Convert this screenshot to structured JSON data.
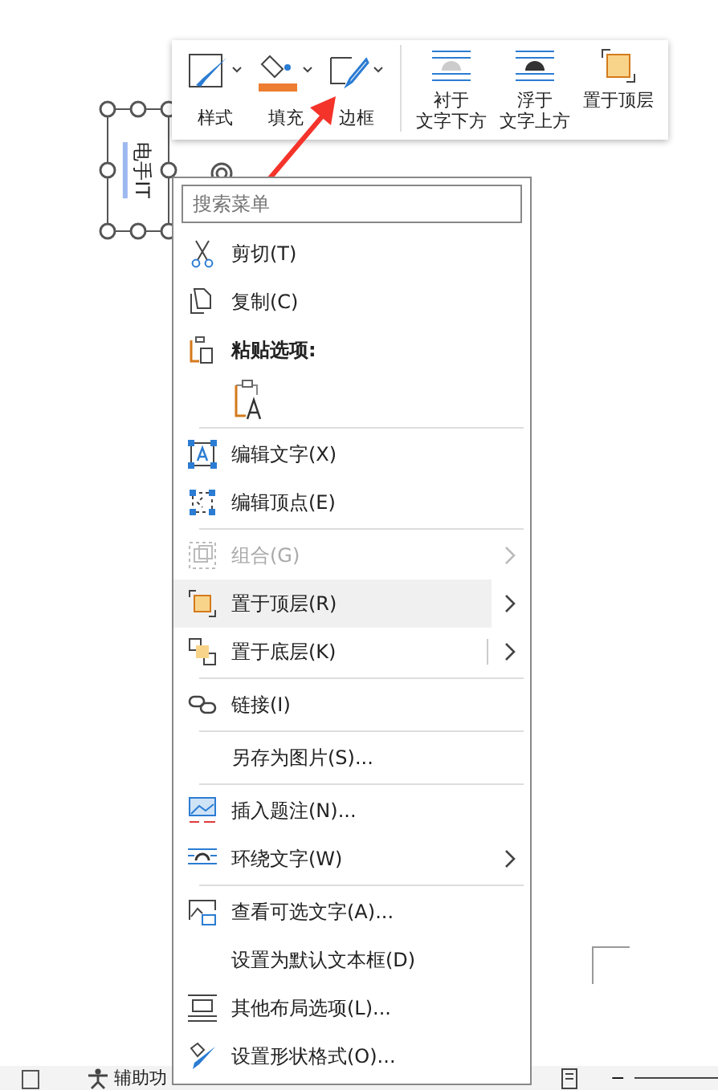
{
  "text_box": {
    "text": "电手IT"
  },
  "toolbar": {
    "format": [
      {
        "label": "样式",
        "dropdown": true
      },
      {
        "label": "填充",
        "dropdown": true
      },
      {
        "label": "边框",
        "dropdown": true
      }
    ],
    "arrange": [
      {
        "lines": [
          "衬于",
          "文字下方"
        ]
      },
      {
        "lines": [
          "浮于",
          "文字上方"
        ]
      },
      {
        "lines": [
          "置于顶层"
        ]
      }
    ]
  },
  "menu": {
    "search": {
      "placeholder": "搜索菜单"
    },
    "items": [
      {
        "kind": "item",
        "label": "剪切(T)",
        "disabled": false,
        "selected": false,
        "submenu": false,
        "split": false
      },
      {
        "kind": "item",
        "label": "复制(C)",
        "disabled": false,
        "selected": false,
        "submenu": false,
        "split": false
      },
      {
        "kind": "header",
        "label": "粘贴选项:"
      },
      {
        "kind": "paste-option"
      },
      {
        "kind": "divider"
      },
      {
        "kind": "item",
        "label": "编辑文字(X)",
        "disabled": false,
        "selected": false,
        "submenu": false,
        "split": false
      },
      {
        "kind": "item",
        "label": "编辑顶点(E)",
        "disabled": false,
        "selected": false,
        "submenu": false,
        "split": false
      },
      {
        "kind": "divider"
      },
      {
        "kind": "item",
        "label": "组合(G)",
        "disabled": true,
        "selected": false,
        "submenu": true,
        "split": false
      },
      {
        "kind": "item",
        "label": "置于顶层(R)",
        "disabled": false,
        "selected": true,
        "submenu": true,
        "split": false
      },
      {
        "kind": "item",
        "label": "置于底层(K)",
        "disabled": false,
        "selected": false,
        "submenu": true,
        "split": true
      },
      {
        "kind": "divider"
      },
      {
        "kind": "item",
        "label": "链接(I)",
        "disabled": false,
        "selected": false,
        "submenu": false,
        "split": false
      },
      {
        "kind": "divider"
      },
      {
        "kind": "item",
        "label": "另存为图片(S)...",
        "disabled": false,
        "selected": false,
        "submenu": false,
        "split": false
      },
      {
        "kind": "divider"
      },
      {
        "kind": "item",
        "label": "插入题注(N)...",
        "disabled": false,
        "selected": false,
        "submenu": false,
        "split": false
      },
      {
        "kind": "item",
        "label": "环绕文字(W)",
        "disabled": false,
        "selected": false,
        "submenu": true,
        "split": false
      },
      {
        "kind": "divider"
      },
      {
        "kind": "item",
        "label": "查看可选文字(A)...",
        "disabled": false,
        "selected": false,
        "submenu": false,
        "split": false
      },
      {
        "kind": "item",
        "label": "设置为默认文本框(D)",
        "disabled": false,
        "selected": false,
        "submenu": false,
        "split": false
      },
      {
        "kind": "item",
        "label": "其他布局选项(L)...",
        "disabled": false,
        "selected": false,
        "submenu": false,
        "split": false
      },
      {
        "kind": "item",
        "label": "设置形状格式(O)...",
        "disabled": false,
        "selected": false,
        "submenu": false,
        "split": false
      }
    ]
  },
  "status_bar": {
    "accessibility": "辅助功",
    "zoom_out": "−"
  }
}
